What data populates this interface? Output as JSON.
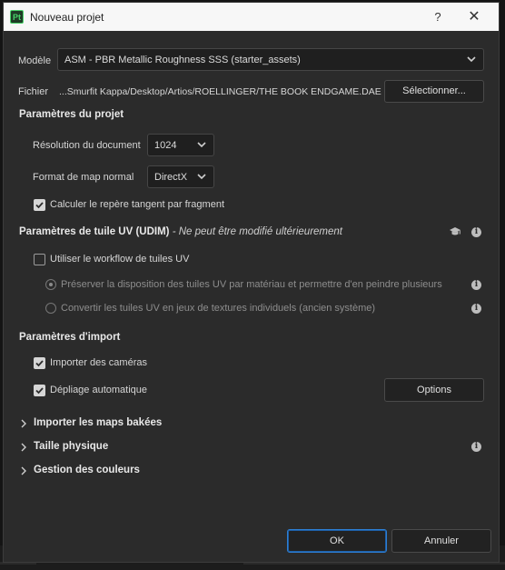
{
  "window": {
    "app_icon": "Pt",
    "title": "Nouveau projet",
    "help": "?",
    "close": "✕"
  },
  "model": {
    "label": "Modèle",
    "value": "ASM - PBR Metallic Roughness SSS (starter_assets)"
  },
  "file": {
    "label": "Fichier",
    "path": "...Smurfit Kappa/Desktop/Artios/ROELLINGER/THE BOOK ENDGAME.DAE",
    "select_button": "Sélectionner..."
  },
  "project": {
    "heading": "Paramètres du projet",
    "resolution_label": "Résolution du document",
    "resolution_value": "1024",
    "normal_format_label": "Format de map normal",
    "normal_format_value": "DirectX",
    "tangent_label": "Calculer le repère tangent par fragment",
    "tangent_checked": true
  },
  "udim": {
    "heading": "Paramètres de tuile UV (UDIM)",
    "note": " - Ne peut être modifié ultérieurement",
    "workflow_label": "Utiliser le workflow de tuiles UV",
    "workflow_checked": false,
    "option1": "Préserver la disposition des tuiles UV par matériau et permettre d'en peindre plusieurs",
    "option2": "Convertir les tuiles UV en jeux de textures individuels (ancien système)",
    "selected_option": 1
  },
  "import": {
    "heading": "Paramètres d'import",
    "cameras_label": "Importer des caméras",
    "cameras_checked": true,
    "unwrap_label": "Dépliage automatique",
    "unwrap_checked": true,
    "options_button": "Options"
  },
  "collapsibles": {
    "baked": "Importer les maps bakées",
    "physical": "Taille physique",
    "colors": "Gestion des couleurs"
  },
  "footer": {
    "ok": "OK",
    "cancel": "Annuler"
  },
  "icons": {
    "info": "info-icon",
    "graduation": "graduation-cap-icon",
    "chevron": "chevron-down-icon",
    "caret": "chevron-right-icon"
  },
  "colors": {
    "accent": "#2e7fd3",
    "logo": "#49d36a",
    "background": "#2b2b2b"
  }
}
